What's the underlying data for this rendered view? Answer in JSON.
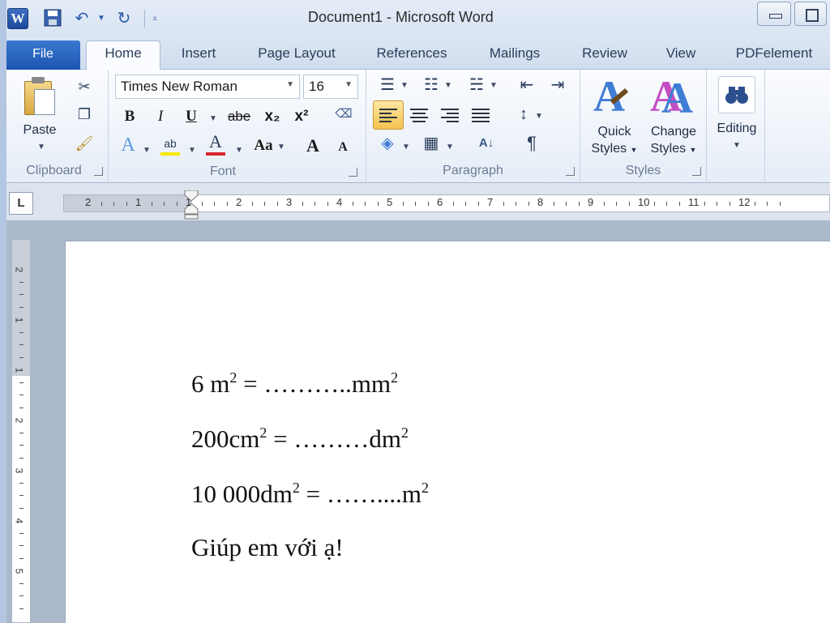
{
  "window": {
    "title": "Document1  -  Microsoft Word",
    "app_icon_letter": "W"
  },
  "tabs": {
    "file": "File",
    "items": [
      "Home",
      "Insert",
      "Page Layout",
      "References",
      "Mailings",
      "Review",
      "View",
      "PDFelement"
    ],
    "active": "Home"
  },
  "ribbon": {
    "clipboard": {
      "paste_label": "Paste",
      "group_label": "Clipboard"
    },
    "font": {
      "font_name": "Times New Roman",
      "font_size": "16",
      "group_label": "Font",
      "bold": "B",
      "italic": "I",
      "underline": "U",
      "strike": "abe",
      "subscript": "x₂",
      "superscript": "x²",
      "change_case": "Aa",
      "grow": "A",
      "shrink": "A"
    },
    "paragraph": {
      "group_label": "Paragraph",
      "pilcrow": "¶"
    },
    "styles": {
      "quick_styles": "Quick Styles",
      "change_styles": "Change Styles",
      "group_label": "Styles"
    },
    "editing": {
      "label": "Editing"
    }
  },
  "ruler": {
    "tab_selector": "L",
    "h_labels": [
      "2",
      "1",
      "1",
      "2",
      "3",
      "4",
      "5",
      "6",
      "7",
      "8",
      "9",
      "10",
      "11",
      "12"
    ],
    "v_labels": [
      "2",
      "1",
      "1",
      "2",
      "3",
      "4",
      "5"
    ]
  },
  "document": {
    "line1": {
      "pre": "6 m",
      "sup1": "2",
      "mid": " = ………..mm",
      "sup2": "2"
    },
    "line2": {
      "pre": "200cm",
      "sup1": "2",
      "mid": " = ………dm",
      "sup2": "2"
    },
    "line3": {
      "pre": "10 000dm",
      "sup1": "2",
      "mid": " = ……....m",
      "sup2": "2"
    },
    "line4": "Giúp em với ạ!"
  },
  "colors": {
    "file_tab": "#1c55b0",
    "active_paragraph_button": "#f6c24f",
    "font_color_bar": "#d8252b",
    "highlight_bar": "#f5e800"
  }
}
